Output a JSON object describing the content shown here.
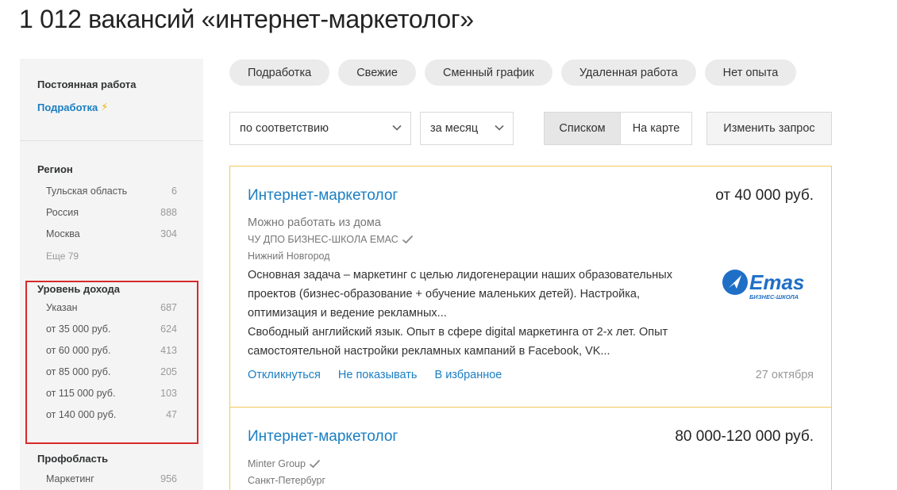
{
  "page_title": "1 012 вакансий «интернет-маркетолог»",
  "colors": {
    "link": "#1a7ec3",
    "accent_border": "#f0c85a",
    "highlight_box": "#d72a2a",
    "bolt": "#f0b400"
  },
  "sidebar": {
    "employment_heading": "Постоянная работа",
    "parttime_link": "Подработка",
    "region": {
      "heading": "Регион",
      "items": [
        {
          "label": "Тульская область",
          "count": "6"
        },
        {
          "label": "Россия",
          "count": "888"
        },
        {
          "label": "Москва",
          "count": "304"
        }
      ],
      "more": "Еще 79"
    },
    "income": {
      "heading": "Уровень дохода",
      "items": [
        {
          "label": "Указан",
          "count": "687"
        },
        {
          "label": "от 35 000 руб.",
          "count": "624"
        },
        {
          "label": "от 60 000 руб.",
          "count": "413"
        },
        {
          "label": "от 85 000 руб.",
          "count": "205"
        },
        {
          "label": "от 115 000 руб.",
          "count": "103"
        },
        {
          "label": "от 140 000 руб.",
          "count": "47"
        }
      ]
    },
    "profarea": {
      "heading": "Профобласть",
      "items": [
        {
          "label": "Маркетинг",
          "count": "956"
        }
      ]
    }
  },
  "chips": [
    "Подработка",
    "Свежие",
    "Сменный график",
    "Удаленная работа",
    "Нет опыта"
  ],
  "controls": {
    "sort_value": "по соответствию",
    "period_value": "за месяц",
    "view_list": "Списком",
    "view_map": "На карте",
    "change_query": "Изменить запрос"
  },
  "vacancies": [
    {
      "title": "Интернет-маркетолог",
      "salary": "от 40 000 руб.",
      "remote": "Можно работать из дома",
      "company": "ЧУ ДПО БИЗНЕС-ШКОЛА ЕМАС",
      "city": "Нижний Новгород",
      "desc_lines": [
        "Основная задача – маркетинг с целью лидогенерации наших образовательных",
        "проектов (бизнес-образование + обучение маленьких детей). Настройка,",
        "оптимизация и ведение рекламных...",
        "Свободный английский язык. Опыт в сфере digital маркетинга от 2-х лет. Опыт",
        "самостоятельной настройки рекламных кампаний в Facebook, VK..."
      ],
      "actions": [
        "Откликнуться",
        "Не показывать",
        "В избранное"
      ],
      "date": "27 октября",
      "logo": {
        "name": "Emas",
        "tagline": "БИЗНЕС-ШКОЛА"
      }
    },
    {
      "title": "Интернет-маркетолог",
      "salary": "80 000-120 000 руб.",
      "company": "Minter Group",
      "city": "Санкт-Петербург"
    }
  ]
}
